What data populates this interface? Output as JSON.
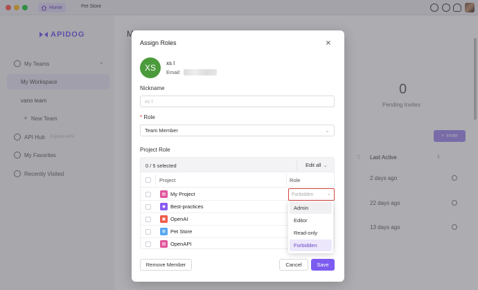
{
  "titlebar": {
    "tabs": [
      {
        "label": "Home",
        "active": true
      },
      {
        "label": "Pet Store",
        "active": false
      }
    ]
  },
  "sidebar": {
    "logo": "APIDOG",
    "my_teams": "My Teams",
    "my_workspace": "My Workspace",
    "team": "vano team",
    "new_team": "New Team",
    "api_hub": "API Hub",
    "explore": "Explore APIs",
    "favorites": "My Favorites",
    "recent": "Recently Visited"
  },
  "main": {
    "heading_initial": "M",
    "pending_count": "0",
    "pending_label": "Pending Invites",
    "invite_label": "Invite",
    "last_active_label": "Last Active",
    "rows": [
      {
        "last_active": "2 days ago"
      },
      {
        "last_active": "22 days ago"
      },
      {
        "last_active": "13 days ago"
      }
    ]
  },
  "modal": {
    "title": "Assign Roles",
    "avatar_initials": "XS",
    "user_name": "xs l",
    "email_label": "Email:",
    "nickname_label": "Nickname",
    "nickname_placeholder": "xs l",
    "role_label": "Role",
    "role_required_mark": "*",
    "role_value": "Team Member",
    "project_role_label": "Project Role",
    "selected_count": "0 / 5 selected",
    "edit_all": "Edit all",
    "col_project": "Project",
    "col_role": "Role",
    "projects": [
      {
        "name": "My Project",
        "color": "#e0569c",
        "glyph": "▤"
      },
      {
        "name": "Best-practices",
        "color": "#8a5cf0",
        "glyph": "◆"
      },
      {
        "name": "OpenAI",
        "color": "#ef5a4a",
        "glyph": "▣"
      },
      {
        "name": "Pet Store",
        "color": "#58a8f0",
        "glyph": "✿"
      },
      {
        "name": "OpenAPI",
        "color": "#e0569c",
        "glyph": "▤"
      }
    ],
    "row_role_value": "Forbidden",
    "role_options": [
      {
        "label": "Admin"
      },
      {
        "label": "Editor"
      },
      {
        "label": "Read-only"
      },
      {
        "label": "Forbidden"
      }
    ],
    "remove_member": "Remove Member",
    "cancel": "Cancel",
    "save": "Save"
  },
  "colors": {
    "accent": "#7c5cf0",
    "error_border": "#d6453d",
    "avatar_bg": "#4b9b3c"
  }
}
